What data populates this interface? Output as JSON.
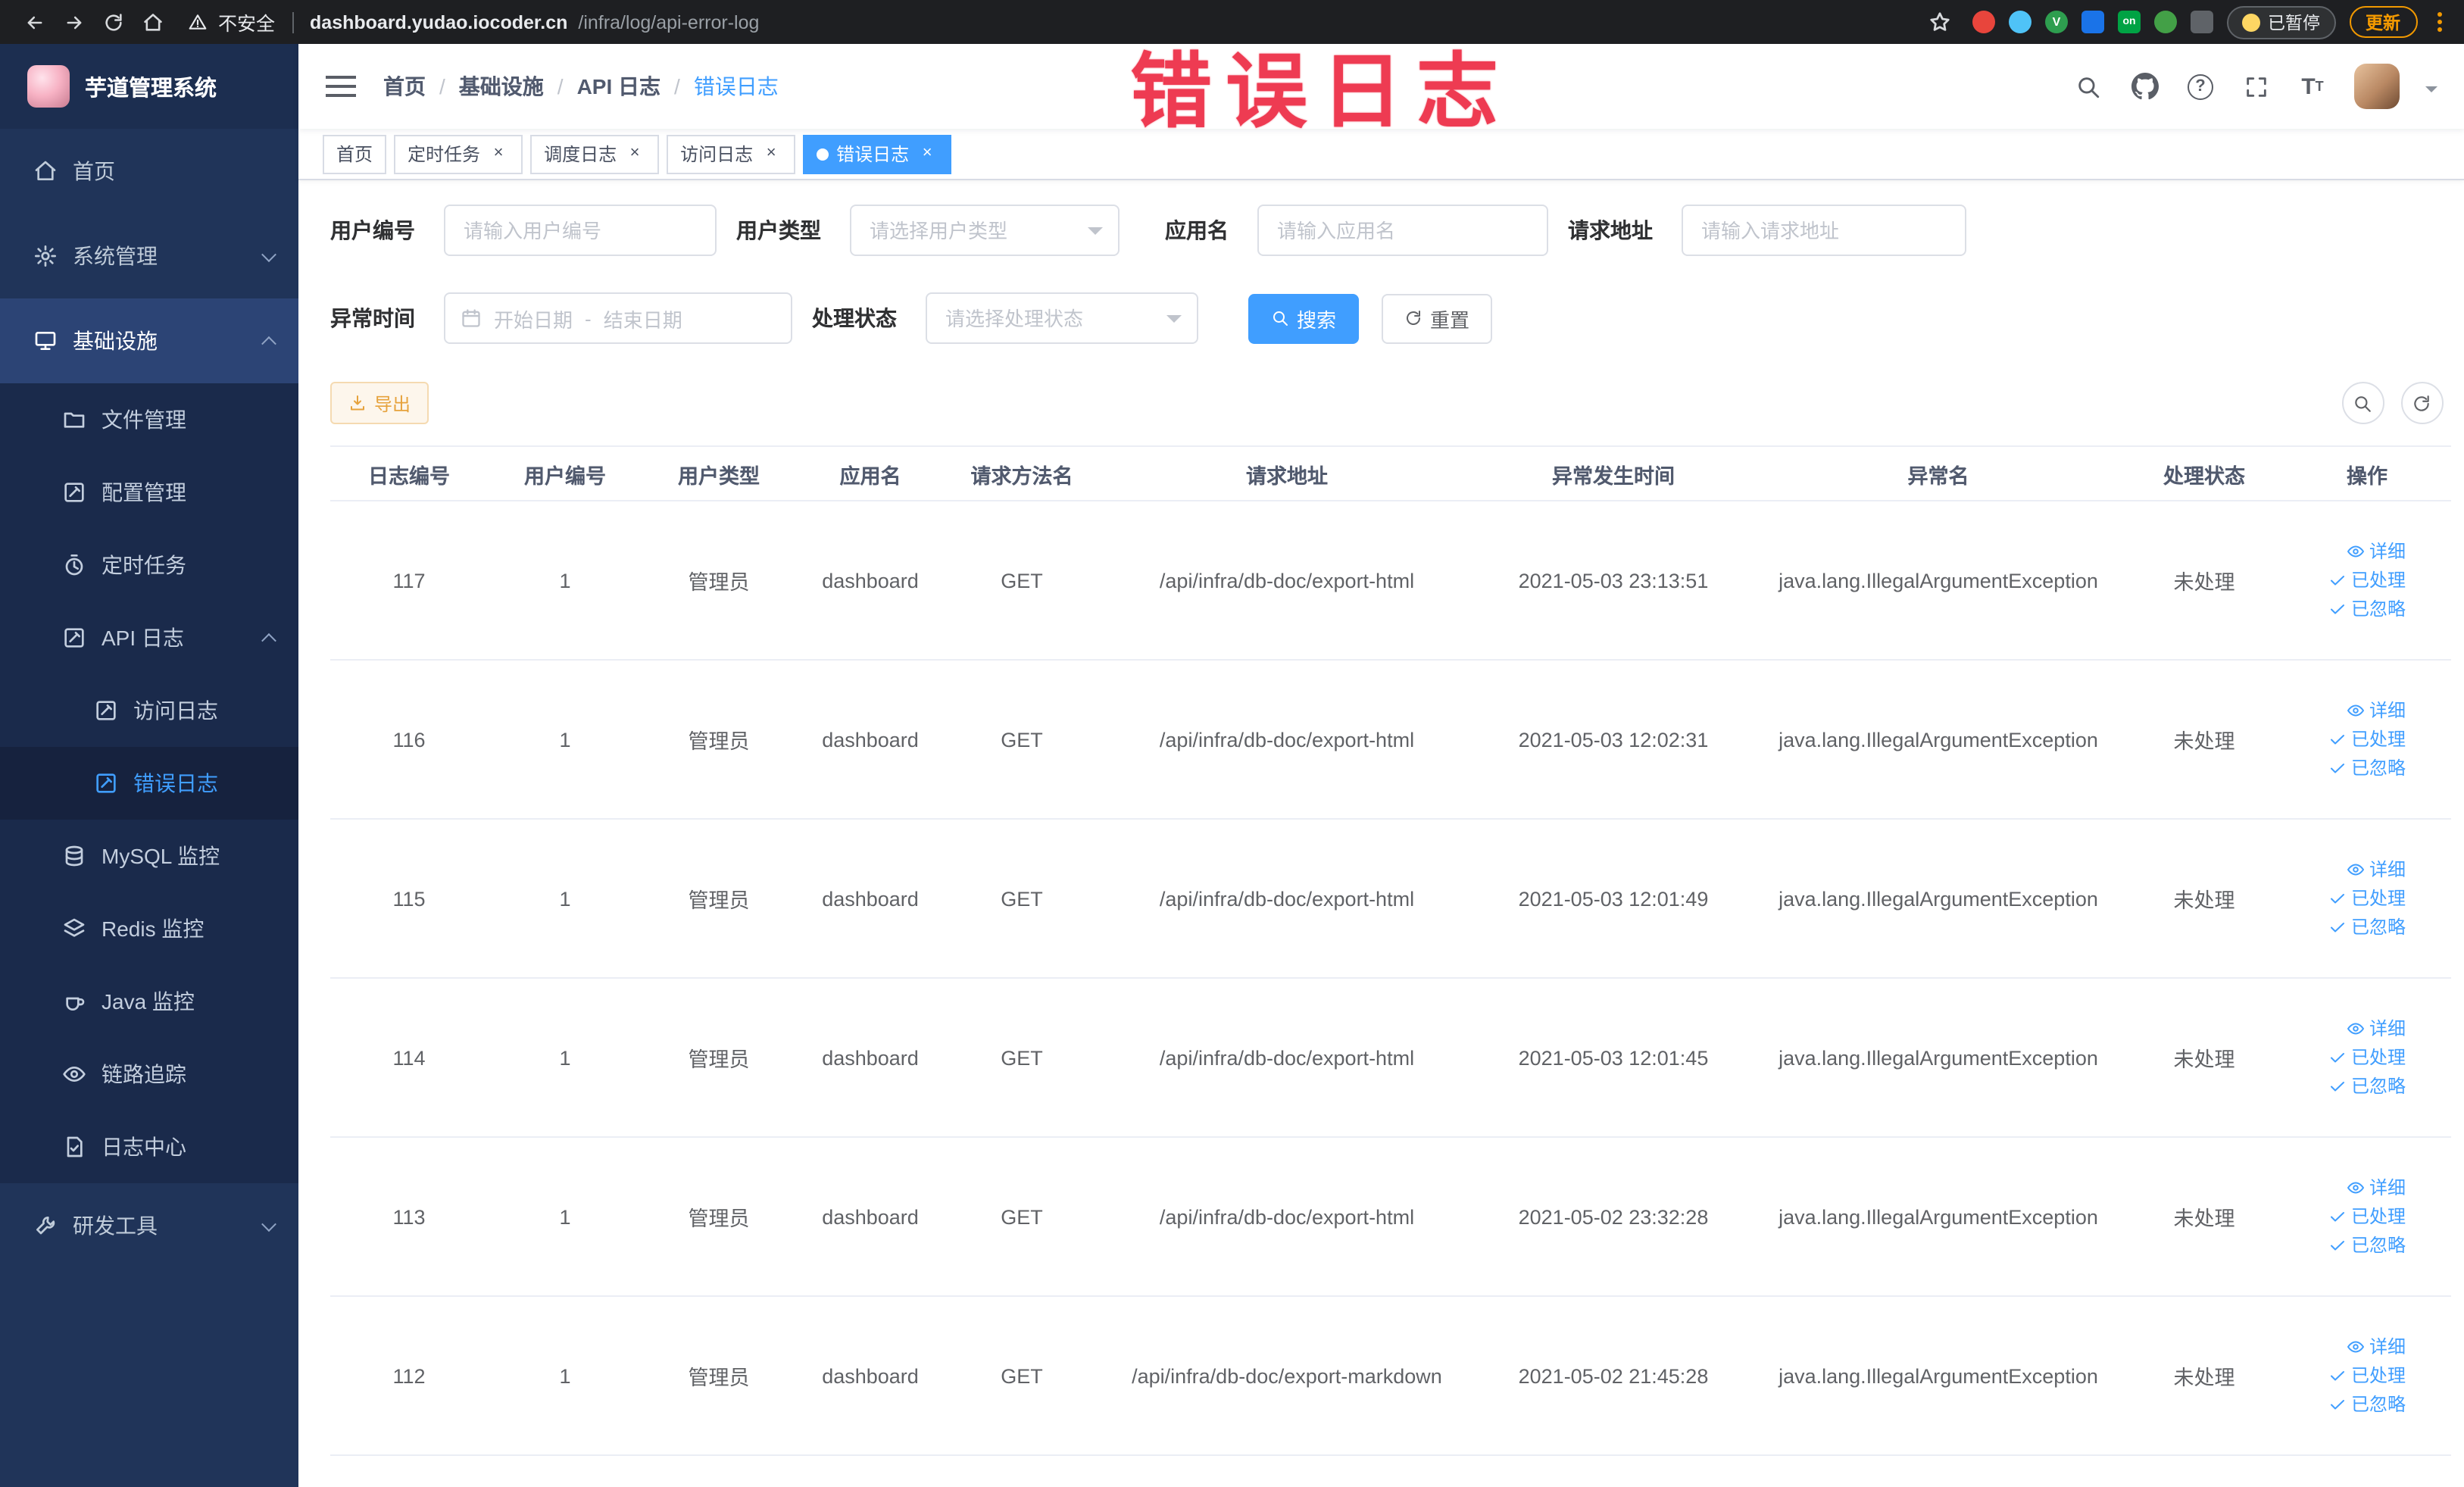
{
  "browser": {
    "security_label": "不安全",
    "url_domain": "dashboard.yudao.iocoder.cn",
    "url_path": "/infra/log/api-error-log",
    "paused_badge": "已暂停",
    "update_button": "更新"
  },
  "sidebar": {
    "logo_title": "芋道管理系统",
    "home": "首页",
    "system_mgmt": "系统管理",
    "infrastructure": "基础设施",
    "file_mgmt": "文件管理",
    "config_mgmt": "配置管理",
    "scheduled_jobs": "定时任务",
    "api_logs": "API 日志",
    "access_log": "访问日志",
    "error_log": "错误日志",
    "mysql_monitor": "MySQL 监控",
    "redis_monitor": "Redis 监控",
    "java_monitor": "Java 监控",
    "trace": "链路追踪",
    "log_center": "日志中心",
    "dev_tools": "研发工具"
  },
  "navbar": {
    "breadcrumb": [
      "首页",
      "基础设施",
      "API 日志",
      "错误日志"
    ]
  },
  "watermark": "错误日志",
  "tags": [
    {
      "label": "首页"
    },
    {
      "label": "定时任务"
    },
    {
      "label": "调度日志"
    },
    {
      "label": "访问日志"
    },
    {
      "label": "错误日志"
    }
  ],
  "filters": {
    "user_id_label": "用户编号",
    "user_id_placeholder": "请输入用户编号",
    "user_type_label": "用户类型",
    "user_type_placeholder": "请选择用户类型",
    "app_name_label": "应用名",
    "app_name_placeholder": "请输入应用名",
    "request_url_label": "请求地址",
    "request_url_placeholder": "请输入请求地址",
    "exception_time_label": "异常时间",
    "date_start_placeholder": "开始日期",
    "date_separator": "-",
    "date_end_placeholder": "结束日期",
    "process_status_label": "处理状态",
    "process_status_placeholder": "请选择处理状态",
    "search_button": "搜索",
    "reset_button": "重置"
  },
  "toolbar": {
    "export_button": "导出"
  },
  "table": {
    "columns": [
      "日志编号",
      "用户编号",
      "用户类型",
      "应用名",
      "请求方法名",
      "请求地址",
      "异常发生时间",
      "异常名",
      "处理状态",
      "操作"
    ],
    "actions": [
      "详细",
      "已处理",
      "已忽略"
    ],
    "rows": [
      {
        "id": "117",
        "user_id": "1",
        "user_type": "管理员",
        "app": "dashboard",
        "method": "GET",
        "url": "/api/infra/db-doc/export-html",
        "time": "2021-05-03 23:13:51",
        "exception": "java.lang.IllegalArgumentException",
        "status": "未处理"
      },
      {
        "id": "116",
        "user_id": "1",
        "user_type": "管理员",
        "app": "dashboard",
        "method": "GET",
        "url": "/api/infra/db-doc/export-html",
        "time": "2021-05-03 12:02:31",
        "exception": "java.lang.IllegalArgumentException",
        "status": "未处理"
      },
      {
        "id": "115",
        "user_id": "1",
        "user_type": "管理员",
        "app": "dashboard",
        "method": "GET",
        "url": "/api/infra/db-doc/export-html",
        "time": "2021-05-03 12:01:49",
        "exception": "java.lang.IllegalArgumentException",
        "status": "未处理"
      },
      {
        "id": "114",
        "user_id": "1",
        "user_type": "管理员",
        "app": "dashboard",
        "method": "GET",
        "url": "/api/infra/db-doc/export-html",
        "time": "2021-05-03 12:01:45",
        "exception": "java.lang.IllegalArgumentException",
        "status": "未处理"
      },
      {
        "id": "113",
        "user_id": "1",
        "user_type": "管理员",
        "app": "dashboard",
        "method": "GET",
        "url": "/api/infra/db-doc/export-html",
        "time": "2021-05-02 23:32:28",
        "exception": "java.lang.IllegalArgumentException",
        "status": "未处理"
      },
      {
        "id": "112",
        "user_id": "1",
        "user_type": "管理员",
        "app": "dashboard",
        "method": "GET",
        "url": "/api/infra/db-doc/export-markdown",
        "time": "2021-05-02 21:45:28",
        "exception": "java.lang.IllegalArgumentException",
        "status": "未处理"
      }
    ]
  },
  "colors": {
    "accent": "#409eff",
    "warning": "#e6a23c",
    "watermark_red": "#ee3b52",
    "sidebar_bg": "#203459",
    "sidebar_submenu_bg": "#1a2a4b",
    "sidebar_active_bg": "#2c4475"
  }
}
